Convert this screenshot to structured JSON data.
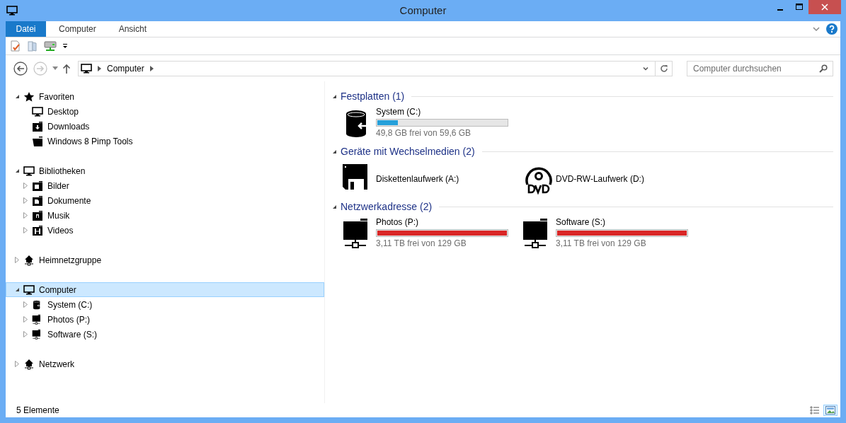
{
  "window": {
    "title": "Computer"
  },
  "ribbon": {
    "tabs": [
      {
        "label": "Datei",
        "kind": "file",
        "selected": false
      },
      {
        "label": "Computer",
        "kind": "tab",
        "selected": false
      },
      {
        "label": "Ansicht",
        "kind": "tab",
        "selected": false
      }
    ]
  },
  "navigation": {
    "back": {
      "disabled": false
    },
    "forward": {
      "disabled": true
    }
  },
  "address": {
    "path": [
      "Computer"
    ]
  },
  "search": {
    "placeholder": "Computer durchsuchen"
  },
  "tree": [
    {
      "label": "Favoriten",
      "kind": "star",
      "expanded": true,
      "selected": false,
      "children": [
        {
          "label": "Desktop",
          "kind": "monitor",
          "selected": false
        },
        {
          "label": "Downloads",
          "kind": "downloads",
          "selected": false
        },
        {
          "label": "Windows 8 Pimp Tools",
          "kind": "folder",
          "selected": false
        }
      ]
    },
    {
      "label": "Bibliotheken",
      "kind": "monitor",
      "expanded": true,
      "selected": false,
      "children": [
        {
          "label": "Bilder",
          "kind": "pictures",
          "expanded": false,
          "selected": false
        },
        {
          "label": "Dokumente",
          "kind": "documents",
          "expanded": false,
          "selected": false
        },
        {
          "label": "Musik",
          "kind": "music",
          "expanded": false,
          "selected": false
        },
        {
          "label": "Videos",
          "kind": "videos",
          "expanded": false,
          "selected": false
        }
      ]
    },
    {
      "label": "Heimnetzgruppe",
      "kind": "homegroup",
      "expanded": false,
      "selected": false
    },
    {
      "label": "Computer",
      "kind": "monitor",
      "expanded": true,
      "selected": true,
      "children": [
        {
          "label": "System (C:)",
          "kind": "disk",
          "expanded": false,
          "selected": false
        },
        {
          "label": "Photos (P:)",
          "kind": "netdrive",
          "expanded": false,
          "selected": false
        },
        {
          "label": "Software (S:)",
          "kind": "netdrive",
          "expanded": false,
          "selected": false
        }
      ]
    },
    {
      "label": "Netzwerk",
      "kind": "homegroup",
      "expanded": false,
      "selected": false
    }
  ],
  "sections": [
    {
      "title": "Festplatten (1)",
      "expanded": true,
      "items": [
        {
          "kind": "disk",
          "name": "System (C:)",
          "level": 0.16,
          "color": "#26a0da",
          "space": "49,8 GB frei von 59,6 GB"
        }
      ]
    },
    {
      "title": "Geräte mit Wechselmedien (2)",
      "expanded": true,
      "items": [
        {
          "kind": "floppy",
          "name": "Diskettenlaufwerk (A:)"
        },
        {
          "kind": "dvd",
          "name": "DVD-RW-Laufwerk (D:)"
        }
      ]
    },
    {
      "title": "Netzwerkadresse (2)",
      "expanded": true,
      "items": [
        {
          "kind": "netdrive",
          "name": "Photos (P:)",
          "level": 1,
          "color": "#da2626",
          "space": "3,11 TB frei von 129 GB"
        },
        {
          "kind": "netdrive",
          "name": "Software (S:)",
          "level": 1,
          "color": "#da2626",
          "space": "3,11 TB frei von 129 GB"
        }
      ]
    }
  ],
  "status_bar": {
    "count": "5 Elemente",
    "views": [
      {
        "kind": "details",
        "selected": false
      },
      {
        "kind": "tiles",
        "selected": true
      }
    ]
  }
}
